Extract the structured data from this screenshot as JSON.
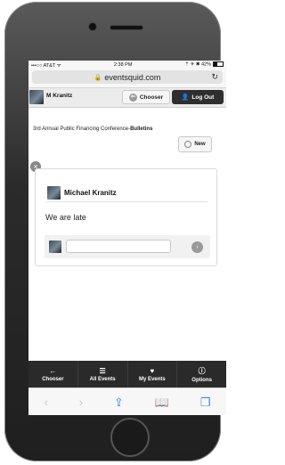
{
  "status_bar": {
    "carrier": "•••○○ AT&T ᯤ",
    "time": "2:38 PM",
    "right": "⇡ ✈ ✱ 42%"
  },
  "url_bar": {
    "domain": "eventsquid.com"
  },
  "top_bar": {
    "user_name": "M Kranitz",
    "chooser_label": "Chooser",
    "logout_label": "Log Out"
  },
  "breadcrumb": {
    "prefix": "3rd Annual Public Financing Conference-",
    "current": "Bulletins"
  },
  "new_label": "New",
  "bulletin": {
    "author": "Michael Kranitz",
    "message": "We are late",
    "reply_value": ""
  },
  "tabs": [
    {
      "label": "Chooser",
      "icon": "arrow-left-icon"
    },
    {
      "label": "All Events",
      "icon": "list-icon"
    },
    {
      "label": "My Events",
      "icon": "heart-icon"
    },
    {
      "label": "Options",
      "icon": "info-icon"
    }
  ]
}
